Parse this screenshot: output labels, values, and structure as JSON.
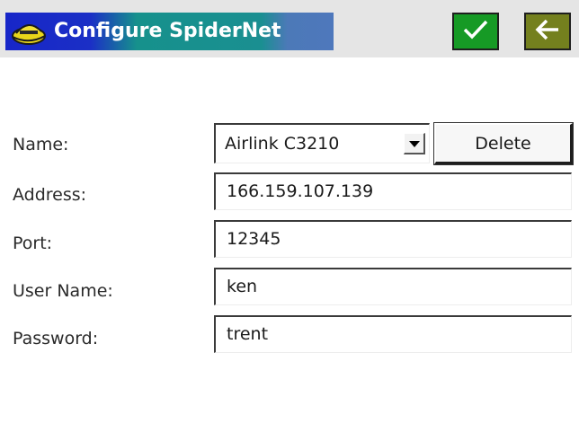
{
  "window": {
    "title": "Configure SpiderNet"
  },
  "toolbar": {
    "ok_icon": "checkmark-icon",
    "back_icon": "arrow-left-icon"
  },
  "form": {
    "name_label": "Name:",
    "name_value": "Airlink C3210",
    "delete_label": "Delete",
    "address_label": "Address:",
    "address_value": "166.159.107.139",
    "port_label": "Port:",
    "port_value": "12345",
    "username_label": "User Name:",
    "username_value": "ken",
    "password_label": "Password:",
    "password_value": "trent"
  },
  "colors": {
    "title_blue": "#1b2fc6",
    "title_teal": "#16918c",
    "ok_green": "#169a25",
    "back_olive": "#74801e"
  }
}
